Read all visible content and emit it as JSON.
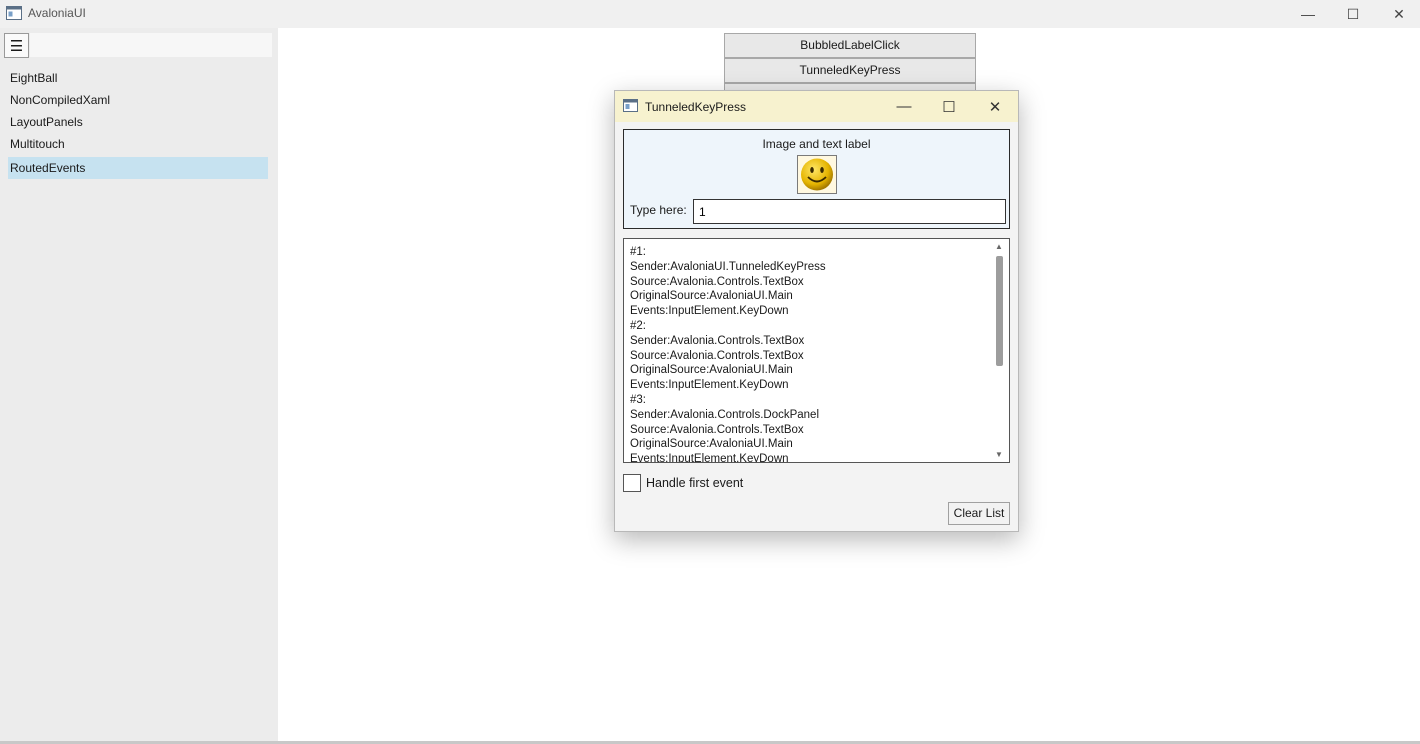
{
  "window": {
    "title": "AvaloniaUI",
    "minimize": "—",
    "maximize": "☐",
    "close": "✕"
  },
  "sidebar": {
    "menu_icon": "hamburger-icon",
    "menu_glyph": "☰",
    "items": [
      {
        "label": "EightBall"
      },
      {
        "label": "NonCompiledXaml"
      },
      {
        "label": "LayoutPanels"
      },
      {
        "label": "Multitouch"
      },
      {
        "label": "RoutedEvents",
        "selected": true
      }
    ]
  },
  "main": {
    "buttons": [
      "BubbledLabelClick",
      "TunneledKeyPress"
    ]
  },
  "dialog": {
    "title": "TunneledKeyPress",
    "minimize": "—",
    "maximize": "☐",
    "close": "✕",
    "image_label": "Image and text label",
    "image_icon": "smiley-icon",
    "type_label": "Type here:",
    "type_value": "1",
    "log": "#1:\nSender:AvaloniaUI.TunneledKeyPress\nSource:Avalonia.Controls.TextBox\nOriginalSource:AvaloniaUI.Main\nEvents:InputElement.KeyDown\n#2:\nSender:Avalonia.Controls.TextBox\nSource:Avalonia.Controls.TextBox\nOriginalSource:AvaloniaUI.Main\nEvents:InputElement.KeyDown\n#3:\nSender:Avalonia.Controls.DockPanel\nSource:Avalonia.Controls.TextBox\nOriginalSource:AvaloniaUI.Main\nEvents:InputElement.KeyDown",
    "scroll_up": "▲",
    "scroll_down": "▼",
    "handle_first_label": "Handle first event",
    "handle_first_checked": false,
    "clear_label": "Clear List"
  },
  "colors": {
    "dialog_title_bg": "#f7f2cf",
    "selected_nav": "#c6e2f0",
    "image_panel_bg": "#eef5fb"
  }
}
